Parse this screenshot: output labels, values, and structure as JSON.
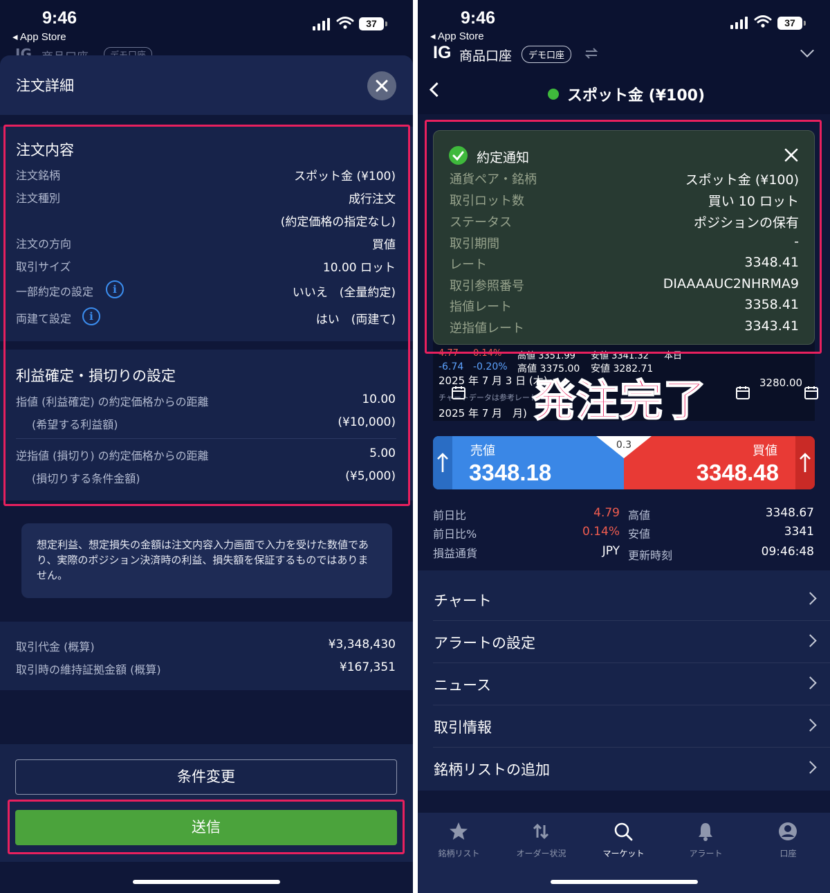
{
  "left": {
    "status": {
      "time": "9:46",
      "back": "◂ App Store",
      "battery": "37"
    },
    "behind_header": {
      "brand": "IG",
      "account": "商品口座",
      "demo": "デモ口座"
    },
    "header": {
      "title": "注文詳細"
    },
    "order": {
      "heading": "注文内容",
      "rows": [
        {
          "label": "注文銘柄",
          "value": "スポット金 (¥100)"
        },
        {
          "label": "注文種別",
          "value": "成行注文",
          "value2": "(約定価格の指定なし)"
        },
        {
          "label": "注文の方向",
          "value": "買値"
        },
        {
          "label": "取引サイズ",
          "value": "10.00 ロット"
        },
        {
          "label": "一部約定の設定",
          "value": "いいえ　(全量約定)"
        },
        {
          "label": "両建て設定",
          "value": "はい　(両建て)"
        }
      ]
    },
    "profit": {
      "heading": "利益確定・損切りの設定",
      "limit_label": "指値 (利益確定) の約定価格からの距離",
      "limit_value": "10.00",
      "limit_sub_label": "(希望する利益額)",
      "limit_sub_value": "(¥10,000)",
      "stop_label": "逆指値 (損切り) の約定価格からの距離",
      "stop_value": "5.00",
      "stop_sub_label": "(損切りする条件金額)",
      "stop_sub_value": "(¥5,000)"
    },
    "disclaimer": "想定利益、想定損失の金額は注文内容入力画面で入力を受けた数値であり、実際のポジション決済時の利益、損失額を保証するものではありません。",
    "costs": [
      {
        "label": "取引代金 (概算)",
        "value": "¥3,348,430"
      },
      {
        "label": "取引時の維持証拠金額 (概算)",
        "value": "¥167,351"
      }
    ],
    "buttons": {
      "modify": "条件変更",
      "submit": "送信"
    }
  },
  "right": {
    "status": {
      "time": "9:46",
      "back": "◂ App Store",
      "battery": "37"
    },
    "header": {
      "brand": "IG",
      "account": "商品口座",
      "demo": "デモ口座"
    },
    "nav": {
      "title": "スポット金 (¥100)"
    },
    "notification": {
      "title": "約定通知",
      "rows": [
        {
          "label": "通貨ペア・銘柄",
          "value": "スポット金 (¥100)"
        },
        {
          "label": "取引ロット数",
          "value": "買い 10 ロット"
        },
        {
          "label": "ステータス",
          "value": "ポジションの保有"
        },
        {
          "label": "取引期間",
          "value": "-"
        },
        {
          "label": "レート",
          "value": "3348.41"
        },
        {
          "label": "取引参照番号",
          "value": "DIAAAAUC2NHRMA9"
        },
        {
          "label": "指値レート",
          "value": "3358.41"
        },
        {
          "label": "逆指値レート",
          "value": "3343.41"
        }
      ]
    },
    "chart_strip": {
      "row1": [
        "4.77",
        "0.14%",
        "高値 3351.99",
        "安値 3341.32",
        "本日"
      ],
      "row2": [
        "-6.74",
        "-0.20%",
        "高値 3375.00",
        "安値 3282.71"
      ],
      "date1": "2025 年 7 月 3 日 (木)",
      "price": "3280.00",
      "note": "チャートデータは参考レート",
      "date2": "2025 年 7 月　月)"
    },
    "overlay_text": "発注完了",
    "quote": {
      "sell_label": "売値",
      "sell_price": "3348.18",
      "buy_label": "買値",
      "buy_price": "3348.48",
      "spread": "0.3",
      "colors": {
        "sell": "#3a87e6",
        "buy": "#e83a35"
      }
    },
    "stats_left": [
      {
        "label": "前日比",
        "value": "4.79",
        "color": "#f05c4f"
      },
      {
        "label": "前日比%",
        "value": "0.14%",
        "color": "#f05c4f"
      },
      {
        "label": "損益通貨",
        "value": "JPY",
        "color": "#ffffff"
      }
    ],
    "stats_right": [
      {
        "label": "高値",
        "value": "3348.67"
      },
      {
        "label": "安値",
        "value": "3341"
      },
      {
        "label": "更新時刻",
        "value": "09:46:48"
      }
    ],
    "menu": [
      "チャート",
      "アラートの設定",
      "ニュース",
      "取引情報",
      "銘柄リストの追加"
    ],
    "tabs": [
      {
        "label": "銘柄リスト",
        "icon": "star-icon"
      },
      {
        "label": "オーダー状況",
        "icon": "arrows-updown-icon"
      },
      {
        "label": "マーケット",
        "icon": "search-icon"
      },
      {
        "label": "アラート",
        "icon": "bell-icon"
      },
      {
        "label": "口座",
        "icon": "account-icon"
      }
    ]
  }
}
